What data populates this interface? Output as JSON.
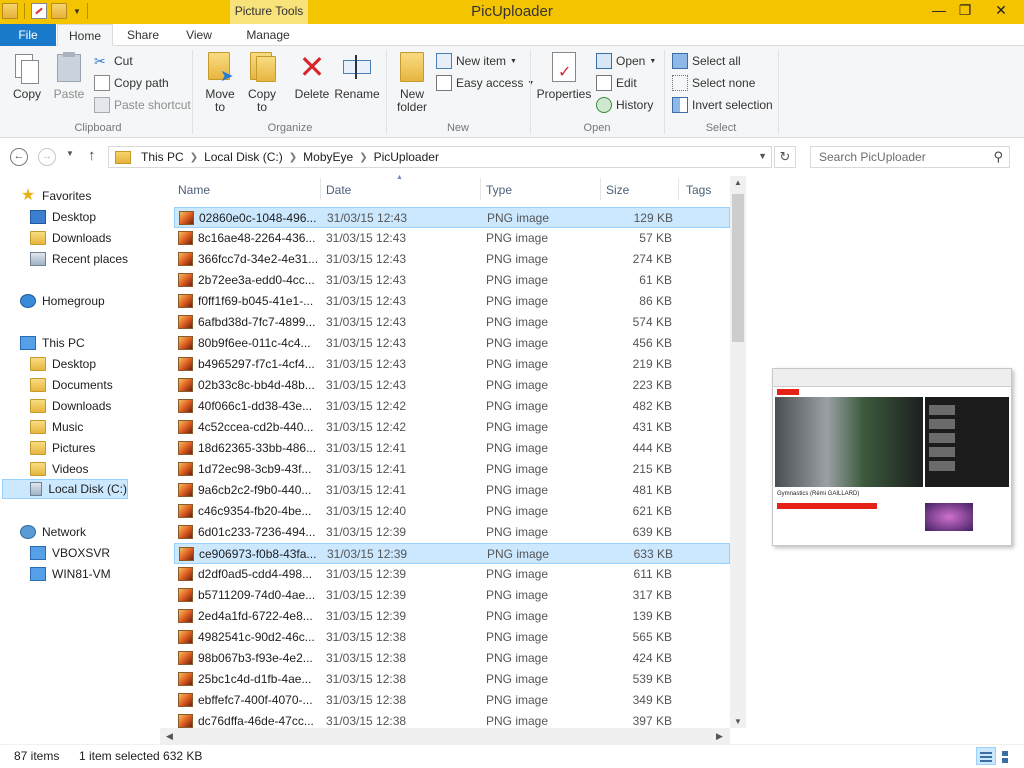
{
  "window": {
    "title": "PicUploader",
    "context_tab_group": "Picture Tools"
  },
  "ribbon_tabs": {
    "file": "File",
    "home": "Home",
    "share": "Share",
    "view": "View",
    "manage": "Manage"
  },
  "ribbon": {
    "clipboard": {
      "group_label": "Clipboard",
      "copy": "Copy",
      "paste": "Paste",
      "cut": "Cut",
      "copy_path": "Copy path",
      "paste_shortcut": "Paste shortcut"
    },
    "organize": {
      "group_label": "Organize",
      "move_to_1": "Move",
      "move_to_2": "to",
      "copy_to_1": "Copy",
      "copy_to_2": "to",
      "delete": "Delete",
      "rename": "Rename"
    },
    "new": {
      "group_label": "New",
      "new_folder_1": "New",
      "new_folder_2": "folder",
      "new_item": "New item",
      "easy_access": "Easy access"
    },
    "open": {
      "group_label": "Open",
      "properties": "Properties",
      "open": "Open",
      "edit": "Edit",
      "history": "History"
    },
    "select": {
      "group_label": "Select",
      "select_all": "Select all",
      "select_none": "Select none",
      "invert_selection": "Invert selection"
    }
  },
  "address": {
    "crumbs": [
      "This PC",
      "Local Disk (C:)",
      "MobyEye",
      "PicUploader"
    ],
    "search_placeholder": "Search PicUploader"
  },
  "nav": {
    "favorites": "Favorites",
    "desktop": "Desktop",
    "downloads": "Downloads",
    "recent_places": "Recent places",
    "homegroup": "Homegroup",
    "this_pc": "This PC",
    "pc_desktop": "Desktop",
    "documents": "Documents",
    "pc_downloads": "Downloads",
    "music": "Music",
    "pictures": "Pictures",
    "videos": "Videos",
    "local_disk": "Local Disk (C:)",
    "network": "Network",
    "vboxsvr": "VBOXSVR",
    "win81vm": "WIN81-VM"
  },
  "columns": {
    "name": "Name",
    "date": "Date",
    "type": "Type",
    "size": "Size",
    "tags": "Tags"
  },
  "files": [
    {
      "name": "02860e0c-1048-496...",
      "date": "31/03/15 12:43",
      "type": "PNG image",
      "size": "129 KB"
    },
    {
      "name": "8c16ae48-2264-436...",
      "date": "31/03/15 12:43",
      "type": "PNG image",
      "size": "57 KB"
    },
    {
      "name": "366fcc7d-34e2-4e31...",
      "date": "31/03/15 12:43",
      "type": "PNG image",
      "size": "274 KB"
    },
    {
      "name": "2b72ee3a-edd0-4cc...",
      "date": "31/03/15 12:43",
      "type": "PNG image",
      "size": "61 KB"
    },
    {
      "name": "f0ff1f69-b045-41e1-...",
      "date": "31/03/15 12:43",
      "type": "PNG image",
      "size": "86 KB"
    },
    {
      "name": "6afbd38d-7fc7-4899...",
      "date": "31/03/15 12:43",
      "type": "PNG image",
      "size": "574 KB"
    },
    {
      "name": "80b9f6ee-011c-4c4...",
      "date": "31/03/15 12:43",
      "type": "PNG image",
      "size": "456 KB"
    },
    {
      "name": "b4965297-f7c1-4cf4...",
      "date": "31/03/15 12:43",
      "type": "PNG image",
      "size": "219 KB"
    },
    {
      "name": "02b33c8c-bb4d-48b...",
      "date": "31/03/15 12:43",
      "type": "PNG image",
      "size": "223 KB"
    },
    {
      "name": "40f066c1-dd38-43e...",
      "date": "31/03/15 12:42",
      "type": "PNG image",
      "size": "482 KB"
    },
    {
      "name": "4c52ccea-cd2b-440...",
      "date": "31/03/15 12:42",
      "type": "PNG image",
      "size": "431 KB"
    },
    {
      "name": "18d62365-33bb-486...",
      "date": "31/03/15 12:41",
      "type": "PNG image",
      "size": "444 KB"
    },
    {
      "name": "1d72ec98-3cb9-43f...",
      "date": "31/03/15 12:41",
      "type": "PNG image",
      "size": "215 KB"
    },
    {
      "name": "9a6cb2c2-f9b0-440...",
      "date": "31/03/15 12:41",
      "type": "PNG image",
      "size": "481 KB"
    },
    {
      "name": "c46c9354-fb20-4be...",
      "date": "31/03/15 12:40",
      "type": "PNG image",
      "size": "621 KB"
    },
    {
      "name": "6d01c233-7236-494...",
      "date": "31/03/15 12:39",
      "type": "PNG image",
      "size": "639 KB"
    },
    {
      "name": "ce906973-f0b8-43fa...",
      "date": "31/03/15 12:39",
      "type": "PNG image",
      "size": "633 KB"
    },
    {
      "name": "d2df0ad5-cdd4-498...",
      "date": "31/03/15 12:39",
      "type": "PNG image",
      "size": "611 KB"
    },
    {
      "name": "b5711209-74d0-4ae...",
      "date": "31/03/15 12:39",
      "type": "PNG image",
      "size": "317 KB"
    },
    {
      "name": "2ed4a1fd-6722-4e8...",
      "date": "31/03/15 12:39",
      "type": "PNG image",
      "size": "139 KB"
    },
    {
      "name": "4982541c-90d2-46c...",
      "date": "31/03/15 12:38",
      "type": "PNG image",
      "size": "565 KB"
    },
    {
      "name": "98b067b3-f93e-4e2...",
      "date": "31/03/15 12:38",
      "type": "PNG image",
      "size": "424 KB"
    },
    {
      "name": "25bc1c4d-d1fb-4ae...",
      "date": "31/03/15 12:38",
      "type": "PNG image",
      "size": "539 KB"
    },
    {
      "name": "ebffefc7-400f-4070-...",
      "date": "31/03/15 12:38",
      "type": "PNG image",
      "size": "349 KB"
    },
    {
      "name": "dc76dffa-46de-47cc...",
      "date": "31/03/15 12:38",
      "type": "PNG image",
      "size": "397 KB"
    }
  ],
  "preview": {
    "video_title": "Gymnastics (Rémi GAILLARD)"
  },
  "status": {
    "item_count": "87 items",
    "selection": "1 item selected  632 KB"
  },
  "colors": {
    "titlebar": "#f5c400",
    "file_tab": "#1979ca",
    "selection": "#cce8ff"
  }
}
